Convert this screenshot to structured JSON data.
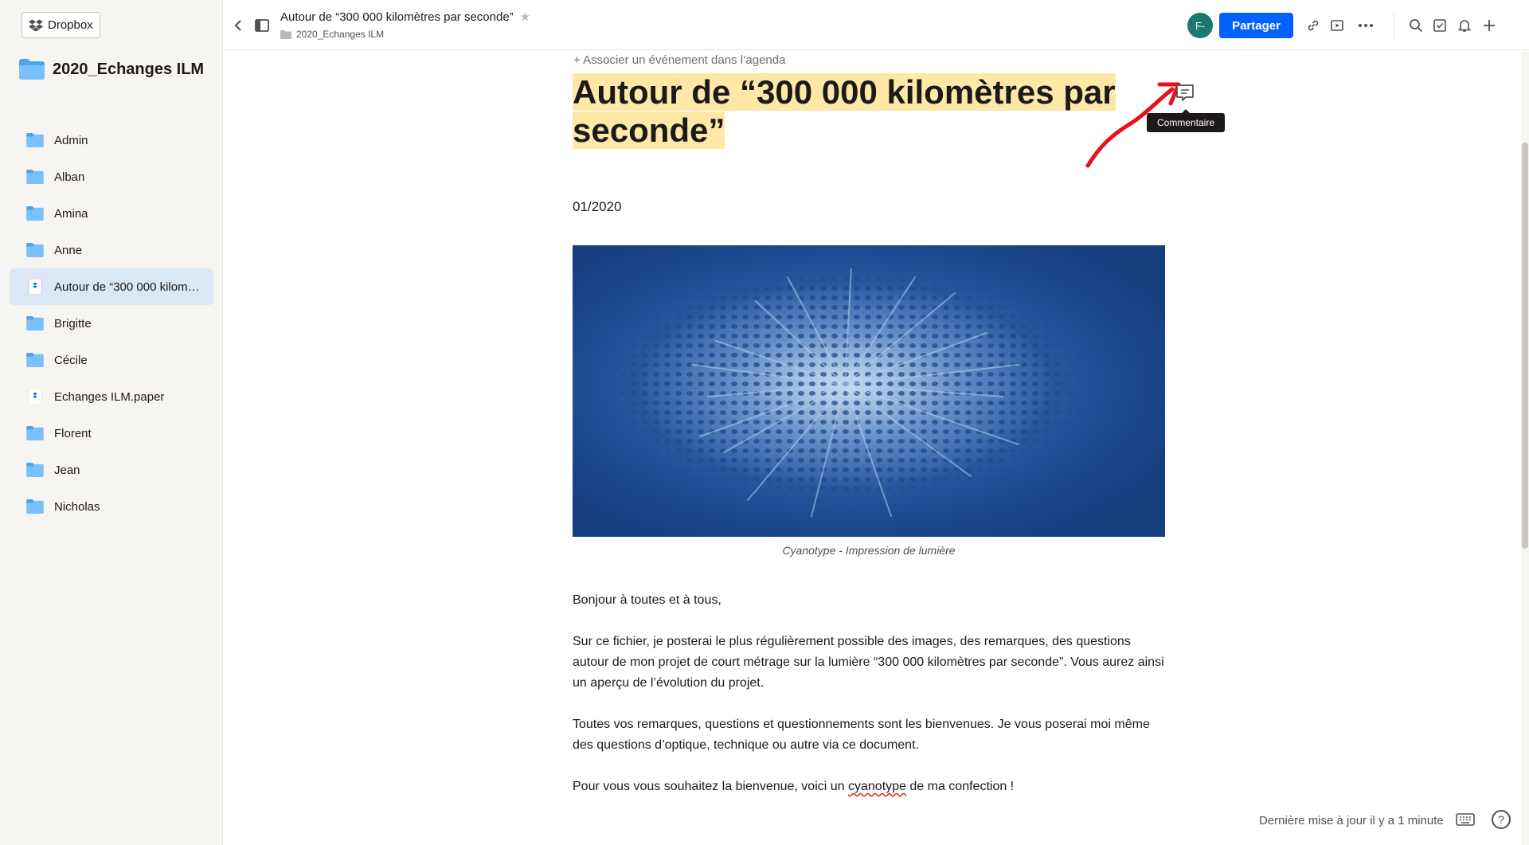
{
  "sidebar": {
    "brand_label": "Dropbox",
    "folder_title": "2020_Echanges ILM",
    "items": [
      {
        "label": "Admin",
        "type": "folder"
      },
      {
        "label": "Alban",
        "type": "folder"
      },
      {
        "label": "Amina",
        "type": "folder"
      },
      {
        "label": "Anne",
        "type": "folder"
      },
      {
        "label": "Autour de “300 000 kilom…",
        "type": "paper",
        "active": true
      },
      {
        "label": "Brigitte",
        "type": "folder"
      },
      {
        "label": "Cécile",
        "type": "folder"
      },
      {
        "label": "Echanges ILM.paper",
        "type": "paper"
      },
      {
        "label": "Florent",
        "type": "folder"
      },
      {
        "label": "Jean",
        "type": "folder"
      },
      {
        "label": "Nicholas",
        "type": "folder"
      }
    ]
  },
  "topbar": {
    "doc_title": "Autour de “300 000 kilomètres par seconde”",
    "breadcrumb": "2020_Echanges ILM",
    "avatar_initials": "F-",
    "share_label": "Partager",
    "icons": [
      "link-icon",
      "present-icon",
      "more-icon",
      "search-icon",
      "checklist-icon",
      "bell-icon",
      "plus-icon"
    ]
  },
  "document": {
    "agenda_link": "+ Associer un événement dans l’agenda",
    "title_line1": "Autour de  “300 000 kilomètres par",
    "title_line2": "seconde”",
    "comment_tooltip": "Commentaire",
    "date": "01/2020",
    "image_caption": "Cyanotype - Impression de lumière",
    "para1": "Bonjour à toutes et à tous,",
    "para2": "Sur ce fichier, je posterai le plus régulièrement possible des images, des remarques, des questions autour de mon projet de court métrage sur la lumière “300 000 kilomètres par seconde”. Vous aurez ainsi un aperçu de l’évolution du projet.",
    "para3": "Toutes vos remarques, questions et questionnements sont les bienvenues. Je  vous poserai moi même des questions d’optique, technique ou autre via ce document.",
    "para4_before": "Pour vous vous souhaitez la bienvenue, voici un ",
    "para4_misspelled": "cyanotype",
    "para4_after": " de ma confection !"
  },
  "footer": {
    "status": "Dernière mise à jour il y a 1 minute",
    "help": "?"
  },
  "colors": {
    "accent": "#0061fe",
    "highlight": "#fde8a8",
    "annotation_arrow": "#e8101a",
    "avatar": "#1a7a6e",
    "cyanotype": "#1c4f94"
  }
}
